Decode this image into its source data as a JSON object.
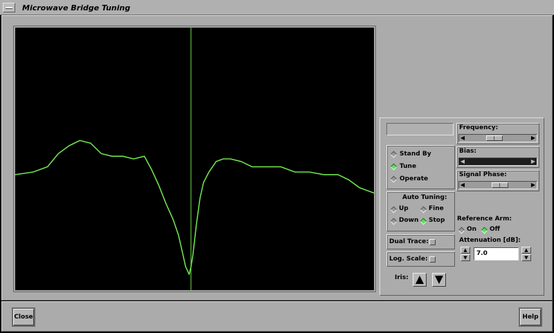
{
  "window": {
    "title": "Microwave Bridge Tuning",
    "menu_icon": "window-menu-icon"
  },
  "plot": {
    "background": "#000000",
    "trace_color": "#6fe24d",
    "marker_color": "#6fe24d",
    "x_range": [
      0,
      1
    ],
    "y_range": [
      0,
      1
    ]
  },
  "chart_data": {
    "type": "line",
    "title": "",
    "xlabel": "",
    "ylabel": "",
    "grid": false,
    "marker_x": 0.49,
    "series": [
      {
        "x": [
          0,
          0.05,
          0.09,
          0.12,
          0.15,
          0.18,
          0.21,
          0.24,
          0.27,
          0.3,
          0.33,
          0.36,
          0.38,
          0.4,
          0.42,
          0.44,
          0.455,
          0.465,
          0.475,
          0.485,
          0.49,
          0.495,
          0.505,
          0.515,
          0.525,
          0.54,
          0.56,
          0.58,
          0.6,
          0.63,
          0.66,
          0.7,
          0.74,
          0.78,
          0.82,
          0.86,
          0.9,
          0.93,
          0.96,
          1.0
        ],
        "y": [
          0.44,
          0.45,
          0.47,
          0.52,
          0.55,
          0.57,
          0.56,
          0.52,
          0.51,
          0.51,
          0.5,
          0.51,
          0.46,
          0.4,
          0.33,
          0.27,
          0.21,
          0.15,
          0.09,
          0.06,
          0.09,
          0.13,
          0.25,
          0.35,
          0.41,
          0.45,
          0.49,
          0.5,
          0.5,
          0.49,
          0.47,
          0.47,
          0.47,
          0.45,
          0.45,
          0.44,
          0.44,
          0.42,
          0.39,
          0.37
        ]
      }
    ]
  },
  "controls": {
    "mode": {
      "options": [
        {
          "label": "Stand By",
          "selected": false
        },
        {
          "label": "Tune",
          "selected": true
        },
        {
          "label": "Operate",
          "selected": false
        }
      ]
    },
    "auto_tuning": {
      "label": "Auto Tuning:",
      "up": {
        "label": "Up",
        "selected": false
      },
      "fine": {
        "label": "Fine",
        "selected": false
      },
      "down": {
        "label": "Down",
        "selected": false
      },
      "stop": {
        "label": "Stop",
        "selected": true
      }
    },
    "dual_trace": {
      "label": "Dual Trace:",
      "checked": false
    },
    "log_scale": {
      "label": "Log. Scale:",
      "checked": false
    },
    "iris": {
      "label": "Iris:",
      "up_icon": "triangle-up-icon",
      "down_icon": "triangle-down-icon"
    },
    "frequency": {
      "label": "Frequency:",
      "level": 0.42
    },
    "bias": {
      "label": "Bias:",
      "level": 0.0
    },
    "signal_phase": {
      "label": "Signal Phase:",
      "level": 0.55
    },
    "reference_arm": {
      "label": "Reference Arm:",
      "on": {
        "label": "On",
        "selected": false
      },
      "off": {
        "label": "Off",
        "selected": true
      }
    },
    "attenuation": {
      "label": "Attenuation [dB]:",
      "value": "7.0"
    },
    "selected_color": "#5ee05a"
  },
  "footer": {
    "close_label": "Close",
    "help_label": "Help"
  }
}
